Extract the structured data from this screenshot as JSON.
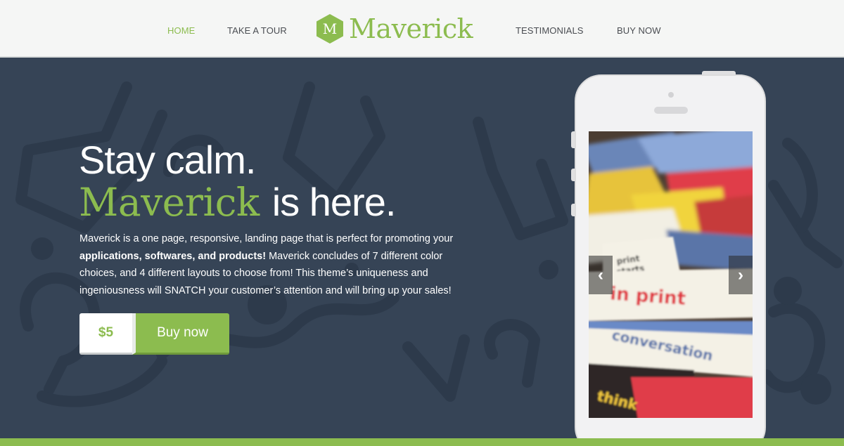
{
  "nav": {
    "home": "HOME",
    "tour": "TAKE A TOUR",
    "testimonials": "TESTIMONIALS",
    "buy": "BUY NOW"
  },
  "logo": {
    "letter": "M",
    "word": "Maverick"
  },
  "hero": {
    "line1": "Stay calm.",
    "accent": "Maverick",
    "tail": "is here.",
    "desc_1": "Maverick is a one page, responsive, landing page that is perfect for promoting your ",
    "desc_bold": "applications, softwares, and products!",
    "desc_2": " Maverick concludes of 7 different color choices, and 4 different layouts to choose from! This theme’s uniqueness and ingeniousness will SNATCH your customer’s attention and will bring up your sales!"
  },
  "buy": {
    "price": "$5",
    "label": "Buy now"
  },
  "phone": {
    "screen_words": [
      "print starts",
      "in print",
      "conversation",
      "think"
    ],
    "prev_icon": "chevron-left-icon",
    "next_icon": "chevron-right-icon",
    "prev_glyph": "‹",
    "next_glyph": "›"
  },
  "colors": {
    "accent": "#8cbc4f",
    "background": "#364456",
    "header": "#f5f6f5"
  }
}
